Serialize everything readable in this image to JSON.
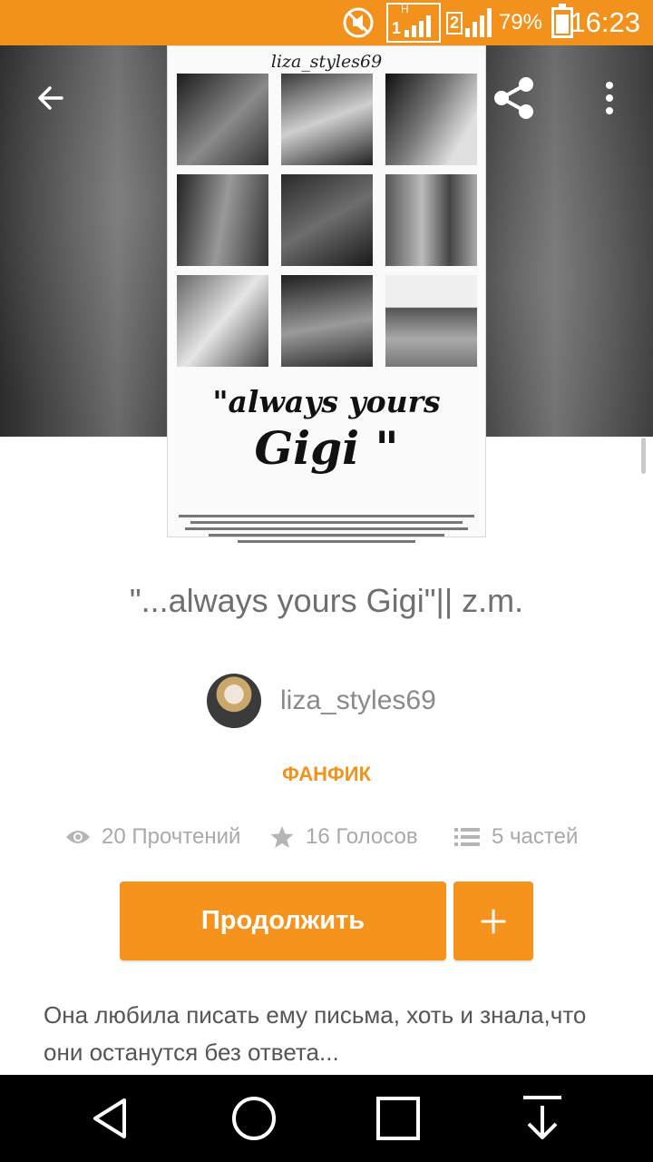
{
  "status_bar": {
    "battery_percent": "79%",
    "time": "16:23",
    "icons": [
      "mute-icon",
      "signal-h-icon",
      "signal-2-icon",
      "battery-icon"
    ]
  },
  "cover": {
    "handle": "liza_styles69",
    "title_line1": "\"always yours",
    "title_line2": "Gigi \""
  },
  "story": {
    "title": "\"...always yours Gigi\"|| z.m.",
    "author": "liza_styles69",
    "category": "ФАНФИК",
    "stats": {
      "reads": "20 Прочтений",
      "votes": "16 Голосов",
      "parts": "5 частей"
    },
    "description": "Она любила писать ему письма, хоть и знала,что они останутся без ответа..."
  },
  "actions": {
    "continue_label": "Продолжить",
    "add_label": "+"
  },
  "colors": {
    "accent": "#f5931d",
    "status_bar": "#f2921d",
    "text_gray": "#6f6f6f",
    "meta_gray": "#a9a9a9"
  }
}
